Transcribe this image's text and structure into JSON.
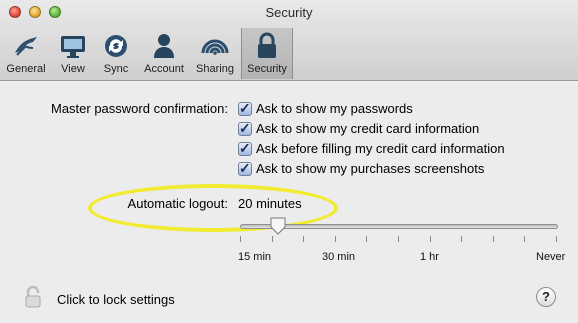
{
  "window": {
    "title": "Security"
  },
  "toolbar": {
    "items": [
      {
        "label": "General",
        "icon": "general-icon"
      },
      {
        "label": "View",
        "icon": "monitor-icon"
      },
      {
        "label": "Sync",
        "icon": "sync-icon"
      },
      {
        "label": "Account",
        "icon": "person-icon"
      },
      {
        "label": "Sharing",
        "icon": "wifi-icon"
      },
      {
        "label": "Security",
        "icon": "lock-icon",
        "selected": true
      }
    ]
  },
  "security": {
    "master_label": "Master password confirmation:",
    "options": [
      {
        "label": "Ask to show my passwords",
        "checked": true
      },
      {
        "label": "Ask to show my credit card information",
        "checked": true
      },
      {
        "label": "Ask before filling my credit card information",
        "checked": true
      },
      {
        "label": "Ask to show my purchases screenshots",
        "checked": true
      }
    ],
    "logout_label": "Automatic logout:",
    "logout_value": "20 minutes",
    "slider": {
      "ticks": [
        "15 min",
        "30 min",
        "1 hr",
        "Never"
      ],
      "level": 0.12
    }
  },
  "footer": {
    "lock_text": "Click to lock settings",
    "help_label": "?"
  },
  "colors": {
    "highlight": "#f1ec32",
    "selected_tab": "#bcbcbc"
  }
}
